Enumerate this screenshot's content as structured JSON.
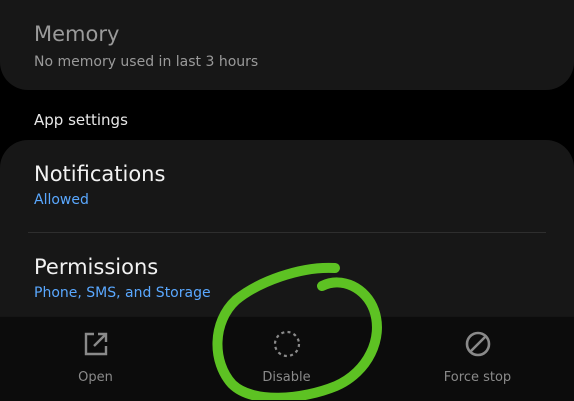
{
  "memory": {
    "title": "Memory",
    "subtitle": "No memory used in last 3 hours"
  },
  "app_settings": {
    "header": "App settings",
    "notifications": {
      "title": "Notifications",
      "value": "Allowed"
    },
    "permissions": {
      "title": "Permissions",
      "value": "Phone, SMS, and Storage"
    }
  },
  "bottom_actions": {
    "open": {
      "label": "Open",
      "icon": "open-external-icon"
    },
    "disable": {
      "label": "Disable",
      "icon": "disable-dashed-circle-icon"
    },
    "force_stop": {
      "label": "Force stop",
      "icon": "block-icon"
    }
  },
  "colors": {
    "accent": "#5aa8ff",
    "annotation": "#5dc223",
    "background": "#000000",
    "card": "#171717"
  }
}
